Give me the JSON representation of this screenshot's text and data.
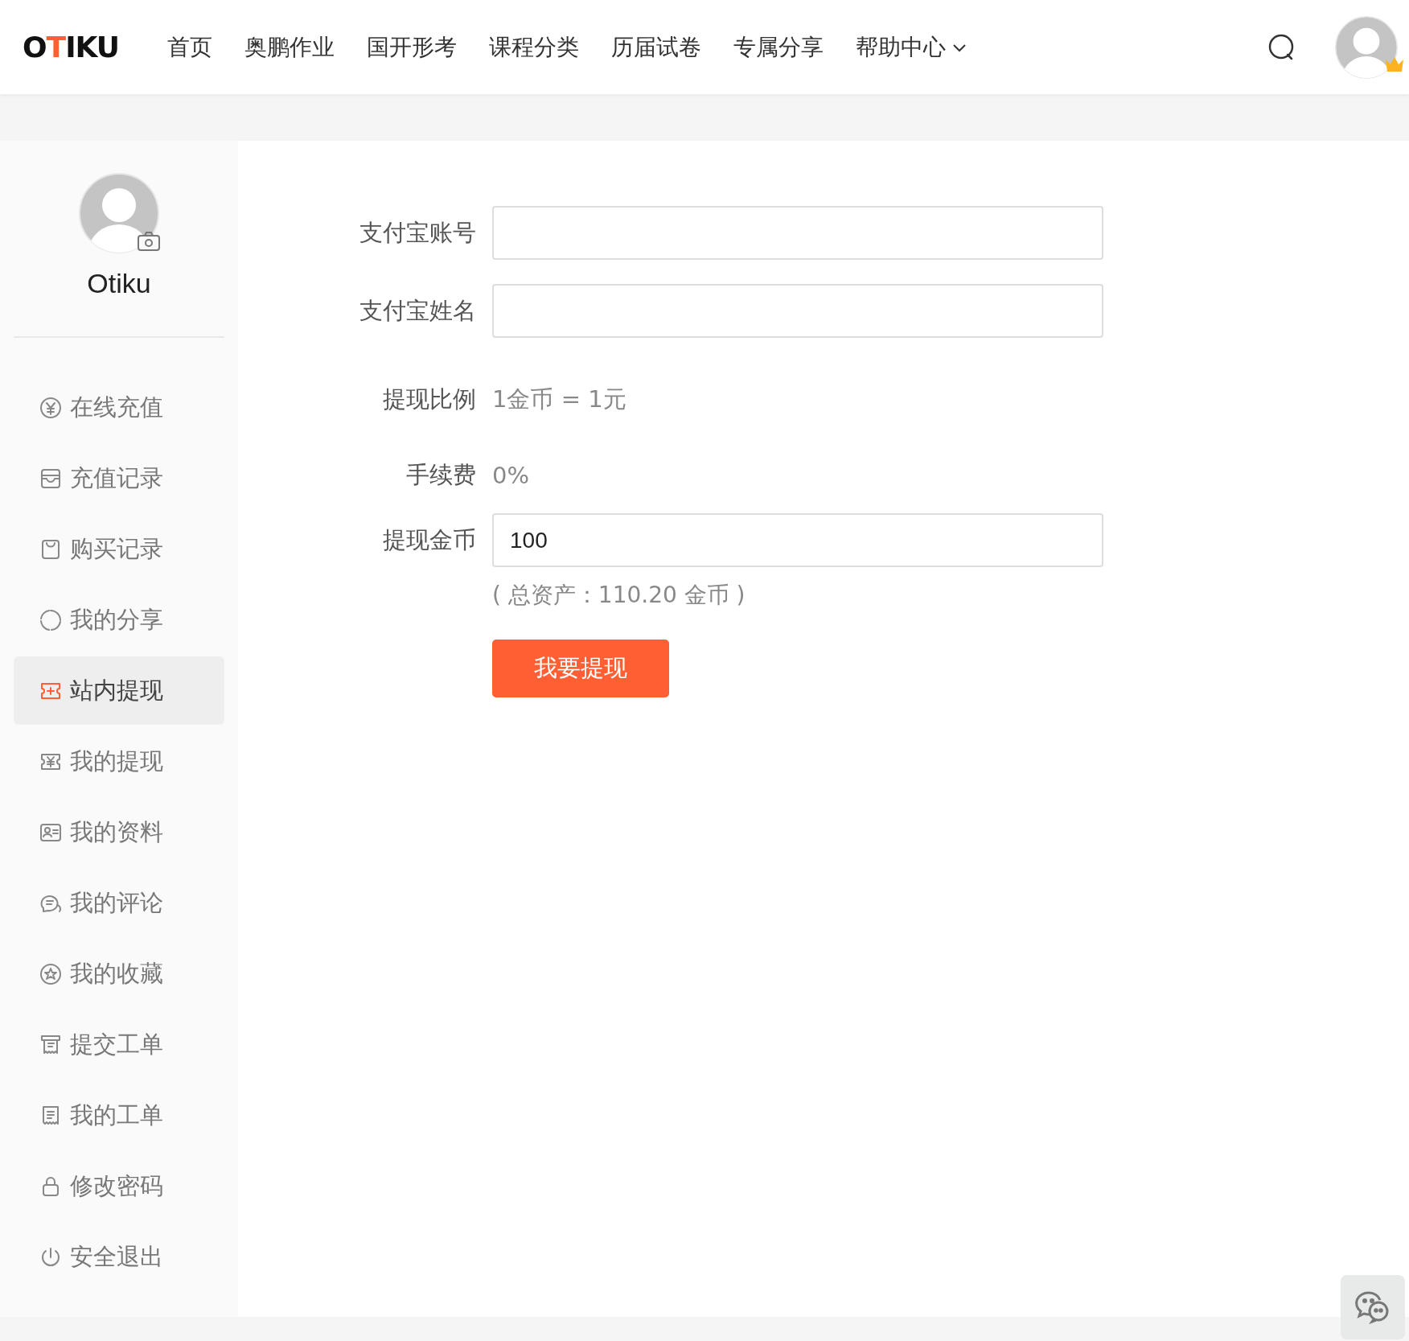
{
  "header": {
    "logo": {
      "parts": [
        {
          "text": "O",
          "accent": false
        },
        {
          "text": "T",
          "accent": true
        },
        {
          "text": "IKU",
          "accent": false
        }
      ]
    },
    "nav": [
      {
        "label": "首页",
        "dropdown": false
      },
      {
        "label": "奥鹏作业",
        "dropdown": false
      },
      {
        "label": "国开形考",
        "dropdown": false
      },
      {
        "label": "课程分类",
        "dropdown": false
      },
      {
        "label": "历届试卷",
        "dropdown": false
      },
      {
        "label": "专属分享",
        "dropdown": false
      },
      {
        "label": "帮助中心",
        "dropdown": true
      }
    ],
    "user": {
      "vip": true
    }
  },
  "sidebar": {
    "username": "Otiku",
    "items": [
      {
        "label": "在线充值",
        "selected": false
      },
      {
        "label": "充值记录",
        "selected": false
      },
      {
        "label": "购买记录",
        "selected": false
      },
      {
        "label": "我的分享",
        "selected": false
      },
      {
        "label": "站内提现",
        "selected": true
      },
      {
        "label": "我的提现",
        "selected": false
      },
      {
        "label": "我的资料",
        "selected": false
      },
      {
        "label": "我的评论",
        "selected": false
      },
      {
        "label": "我的收藏",
        "selected": false
      },
      {
        "label": "提交工单",
        "selected": false
      },
      {
        "label": "我的工单",
        "selected": false
      },
      {
        "label": "修改密码",
        "selected": false
      },
      {
        "label": "安全退出",
        "selected": false
      }
    ]
  },
  "form": {
    "rows": [
      {
        "kind": "input",
        "label": "支付宝账号",
        "value": ""
      },
      {
        "kind": "input",
        "label": "支付宝姓名",
        "value": ""
      },
      {
        "kind": "text",
        "label": "提现比例",
        "value": "1金币 = 1元"
      },
      {
        "kind": "text",
        "label": "手续费",
        "value": "0%"
      },
      {
        "kind": "input",
        "label": "提现金币",
        "value": "100",
        "hint": "( 总资产：110.20 金币 )"
      }
    ],
    "submit": "我要提现"
  }
}
